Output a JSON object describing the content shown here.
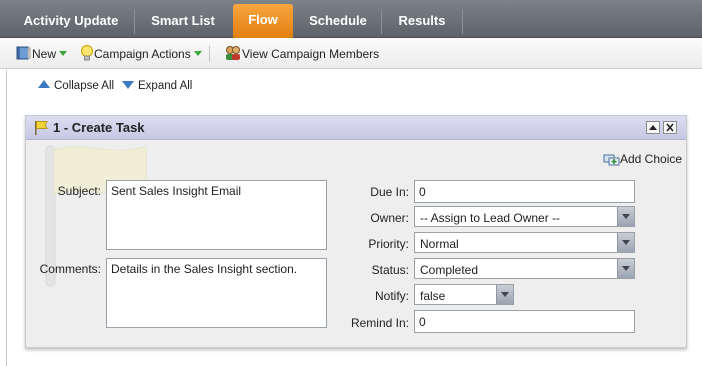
{
  "tabs": [
    {
      "label": "Activity Update"
    },
    {
      "label": "Smart List"
    },
    {
      "label": "Flow",
      "active": true
    },
    {
      "label": "Schedule"
    },
    {
      "label": "Results"
    }
  ],
  "toolbar": {
    "new_label": "New",
    "campaign_actions_label": "Campaign Actions",
    "view_members_label": "View Campaign Members"
  },
  "tree_controls": {
    "collapse_label": "Collapse All",
    "expand_label": "Expand All"
  },
  "step": {
    "title": "1 - Create Task",
    "add_choice_label": "Add Choice",
    "subject_label": "Subject:",
    "subject_value": "Sent Sales Insight Email",
    "comments_label": "Comments:",
    "comments_value": "Details in the Sales Insight section.",
    "due_in_label": "Due In:",
    "due_in_value": "0",
    "owner_label": "Owner:",
    "owner_value": "-- Assign to Lead Owner --",
    "priority_label": "Priority:",
    "priority_value": "Normal",
    "status_label": "Status:",
    "status_value": "Completed",
    "notify_label": "Notify:",
    "notify_value": "false",
    "remind_in_label": "Remind In:",
    "remind_in_value": "0"
  },
  "colors": {
    "active_tab": "#f39a2c",
    "tab_bar": "#6b7076",
    "panel_header": "#cfd0ea",
    "accent_blue": "#3b7ac0"
  }
}
